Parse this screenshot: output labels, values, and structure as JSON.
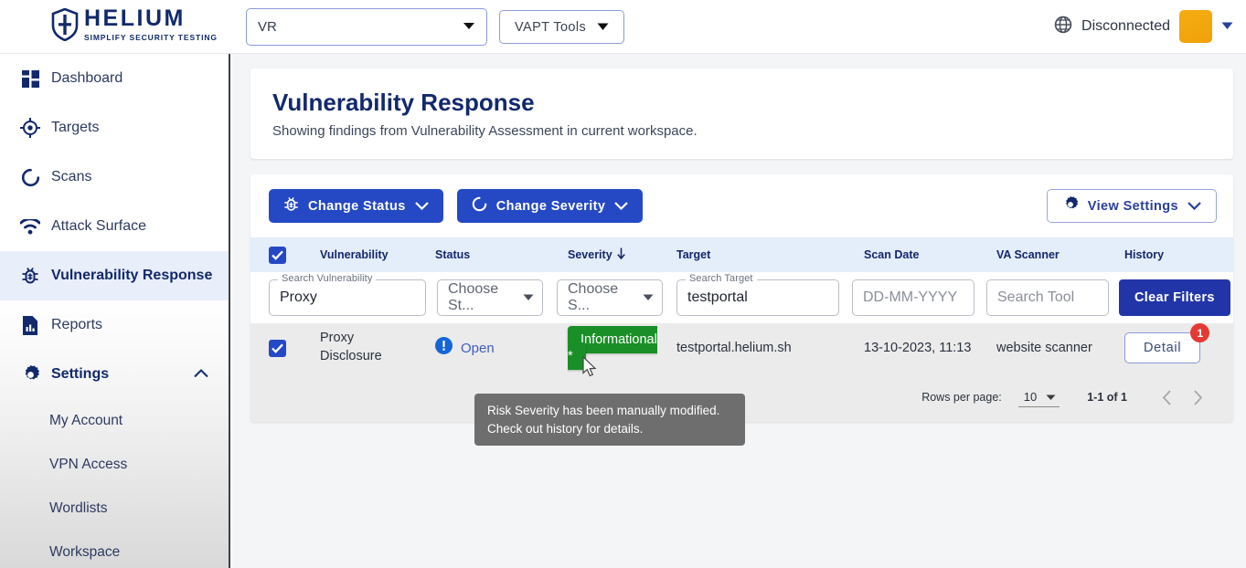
{
  "topbar": {
    "logo_title": "HELIUM",
    "logo_subtitle": "SIMPLIFY SECURITY TESTING",
    "logo_icon": "shield-icon",
    "workspace_value": "VR",
    "workspace_caret_icon": "caret-down-icon",
    "vapt_label": "VAPT Tools",
    "vapt_caret_icon": "caret-down-icon",
    "globe_icon": "globe-icon",
    "connection_status": "Disconnected",
    "avatar_color": "#f0a10a",
    "avatar_caret_icon": "caret-down-icon"
  },
  "sidebar": {
    "items": [
      {
        "label": "Dashboard",
        "icon": "dashboard-grid-icon",
        "active": false
      },
      {
        "label": "Targets",
        "icon": "target-crosshair-icon",
        "active": false
      },
      {
        "label": "Scans",
        "icon": "scan-circle-icon",
        "active": false
      },
      {
        "label": "Attack Surface",
        "icon": "wifi-signal-icon",
        "active": false
      },
      {
        "label": "Vulnerability Response",
        "icon": "bug-icon",
        "active": true
      },
      {
        "label": "Reports",
        "icon": "report-chart-icon",
        "active": false
      },
      {
        "label": "Settings",
        "icon": "gear-icon",
        "active": false,
        "expanded": true,
        "chevron": "chevron-up-icon"
      }
    ],
    "settings_children": [
      {
        "label": "My Account"
      },
      {
        "label": "VPN Access"
      },
      {
        "label": "Wordlists"
      },
      {
        "label": "Workspace"
      }
    ]
  },
  "page": {
    "title": "Vulnerability Response",
    "subtitle": "Showing findings from Vulnerability Assessment in current workspace."
  },
  "toolbar": {
    "change_status_label": "Change Status",
    "change_status_icon": "bug-icon",
    "change_severity_label": "Change Severity",
    "change_severity_icon": "scan-circle-icon",
    "view_settings_label": "View Settings",
    "view_settings_icon": "gear-icon",
    "chevron_icon": "chevron-down-icon",
    "primary_color": "#2549c4"
  },
  "table": {
    "select_all_checked": true,
    "columns": [
      {
        "label": "Vulnerability"
      },
      {
        "label": "Status"
      },
      {
        "label": "Severity",
        "sort_icon": "arrow-down-icon",
        "sorted": true
      },
      {
        "label": "Target"
      },
      {
        "label": "Scan Date"
      },
      {
        "label": "VA Scanner"
      },
      {
        "label": "History"
      }
    ],
    "filters": {
      "vulnerability": {
        "legend": "Search Vulnerability",
        "value": "Proxy"
      },
      "status": {
        "value": "Choose St...",
        "caret_icon": "caret-down-icon"
      },
      "severity": {
        "value": "Choose S...",
        "caret_icon": "caret-down-icon"
      },
      "target": {
        "legend": "Search Target",
        "value": "testportal"
      },
      "scan_date": {
        "placeholder": "DD-MM-YYYY",
        "value": ""
      },
      "tool": {
        "placeholder": "Search Tool",
        "value": ""
      },
      "clear_label": "Clear Filters"
    },
    "rows": [
      {
        "checked": true,
        "vulnerability_line1": "Proxy",
        "vulnerability_line2": "Disclosure",
        "status": "Open",
        "status_icon": "alert-circle-icon",
        "severity": "Informational *",
        "severity_color": "#1a8f27",
        "target": "testportal.helium.sh",
        "scan_date": "13-10-2023, 11:13",
        "va_scanner": "website scanner",
        "history_label": "Detail",
        "history_badge": "1",
        "history_badge_color": "#e53935"
      }
    ],
    "pagination": {
      "rows_per_page_label": "Rows per page:",
      "rows_per_page_value": "10",
      "rows_per_page_caret": "caret-down-icon",
      "range": "1-1 of 1",
      "prev_icon": "chevron-left-icon",
      "next_icon": "chevron-right-icon"
    }
  },
  "tooltip": {
    "line1": "Risk Severity has been manually modified.",
    "line2": "Check out history for details."
  }
}
